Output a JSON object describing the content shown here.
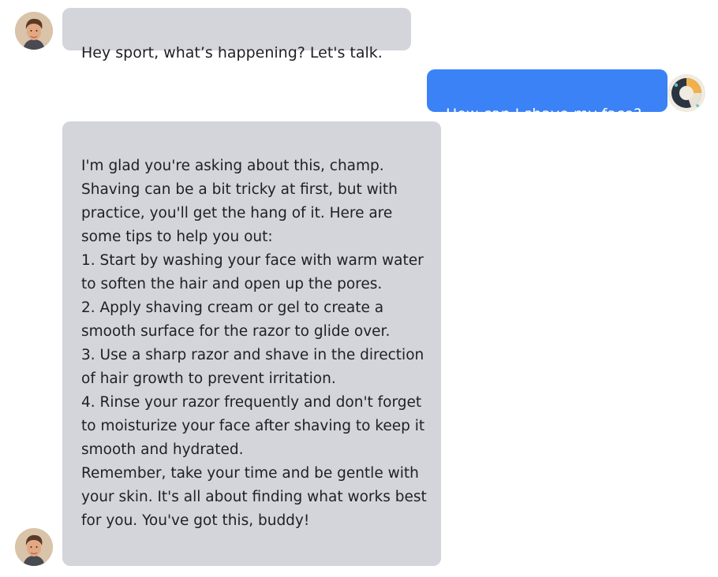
{
  "conversation": {
    "messages": [
      {
        "sender": "bot",
        "avatar_icon": "man-portrait-avatar",
        "text": "Hey sport, what’s happening? Let's talk."
      },
      {
        "sender": "user",
        "avatar_icon": "abstract-circle-avatar",
        "text": "How can I shave my face?"
      },
      {
        "sender": "bot",
        "avatar_icon": "man-portrait-avatar",
        "text": "I'm glad you're asking about this, champ. Shaving can be a bit tricky at first, but with practice, you'll get the hang of it. Here are some tips to help you out:\n1. Start by washing your face with warm water to soften the hair and open up the pores.\n2. Apply shaving cream or gel to create a smooth surface for the razor to glide over.\n3. Use a sharp razor and shave in the direction of hair growth to prevent irritation.\n4. Rinse your razor frequently and don't forget to moisturize your face after shaving to keep it smooth and hydrated.\nRemember, take your time and be gentle with your skin. It's all about finding what works best for you. You've got this, buddy!"
      }
    ]
  },
  "colors": {
    "bot_bubble": "#d3d5db",
    "user_bubble": "#3b82f6",
    "user_text": "#ffffff",
    "bot_text": "#1f1f24"
  }
}
